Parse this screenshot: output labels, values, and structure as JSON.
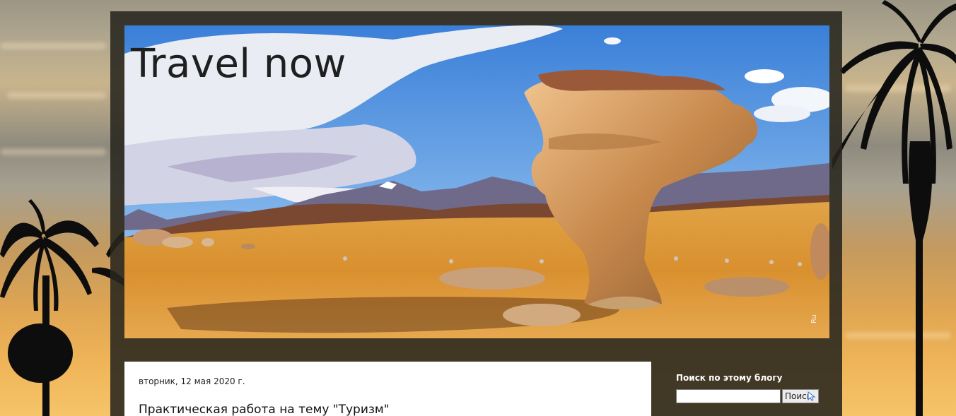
{
  "blog": {
    "title": "Travel now",
    "watermark": "Ru"
  },
  "post": {
    "date": "вторник, 12 мая 2020 г.",
    "title": "Практическая работа на тему \"Туризм\""
  },
  "sidebar": {
    "search_widget_title": "Поиск по этому блогу",
    "search_input_value": "",
    "search_button_label": "Поиск"
  },
  "icons": {
    "header_image": "desert-rock-tree-photo",
    "background": "palm-trees-sunset-background",
    "cursor": "mouse-cursor-icon"
  },
  "colors": {
    "outer_frame": "#28261e",
    "post_background": "#ffffff",
    "sidebar_text": "#ffffff",
    "title_text": "#1f1f1f"
  }
}
